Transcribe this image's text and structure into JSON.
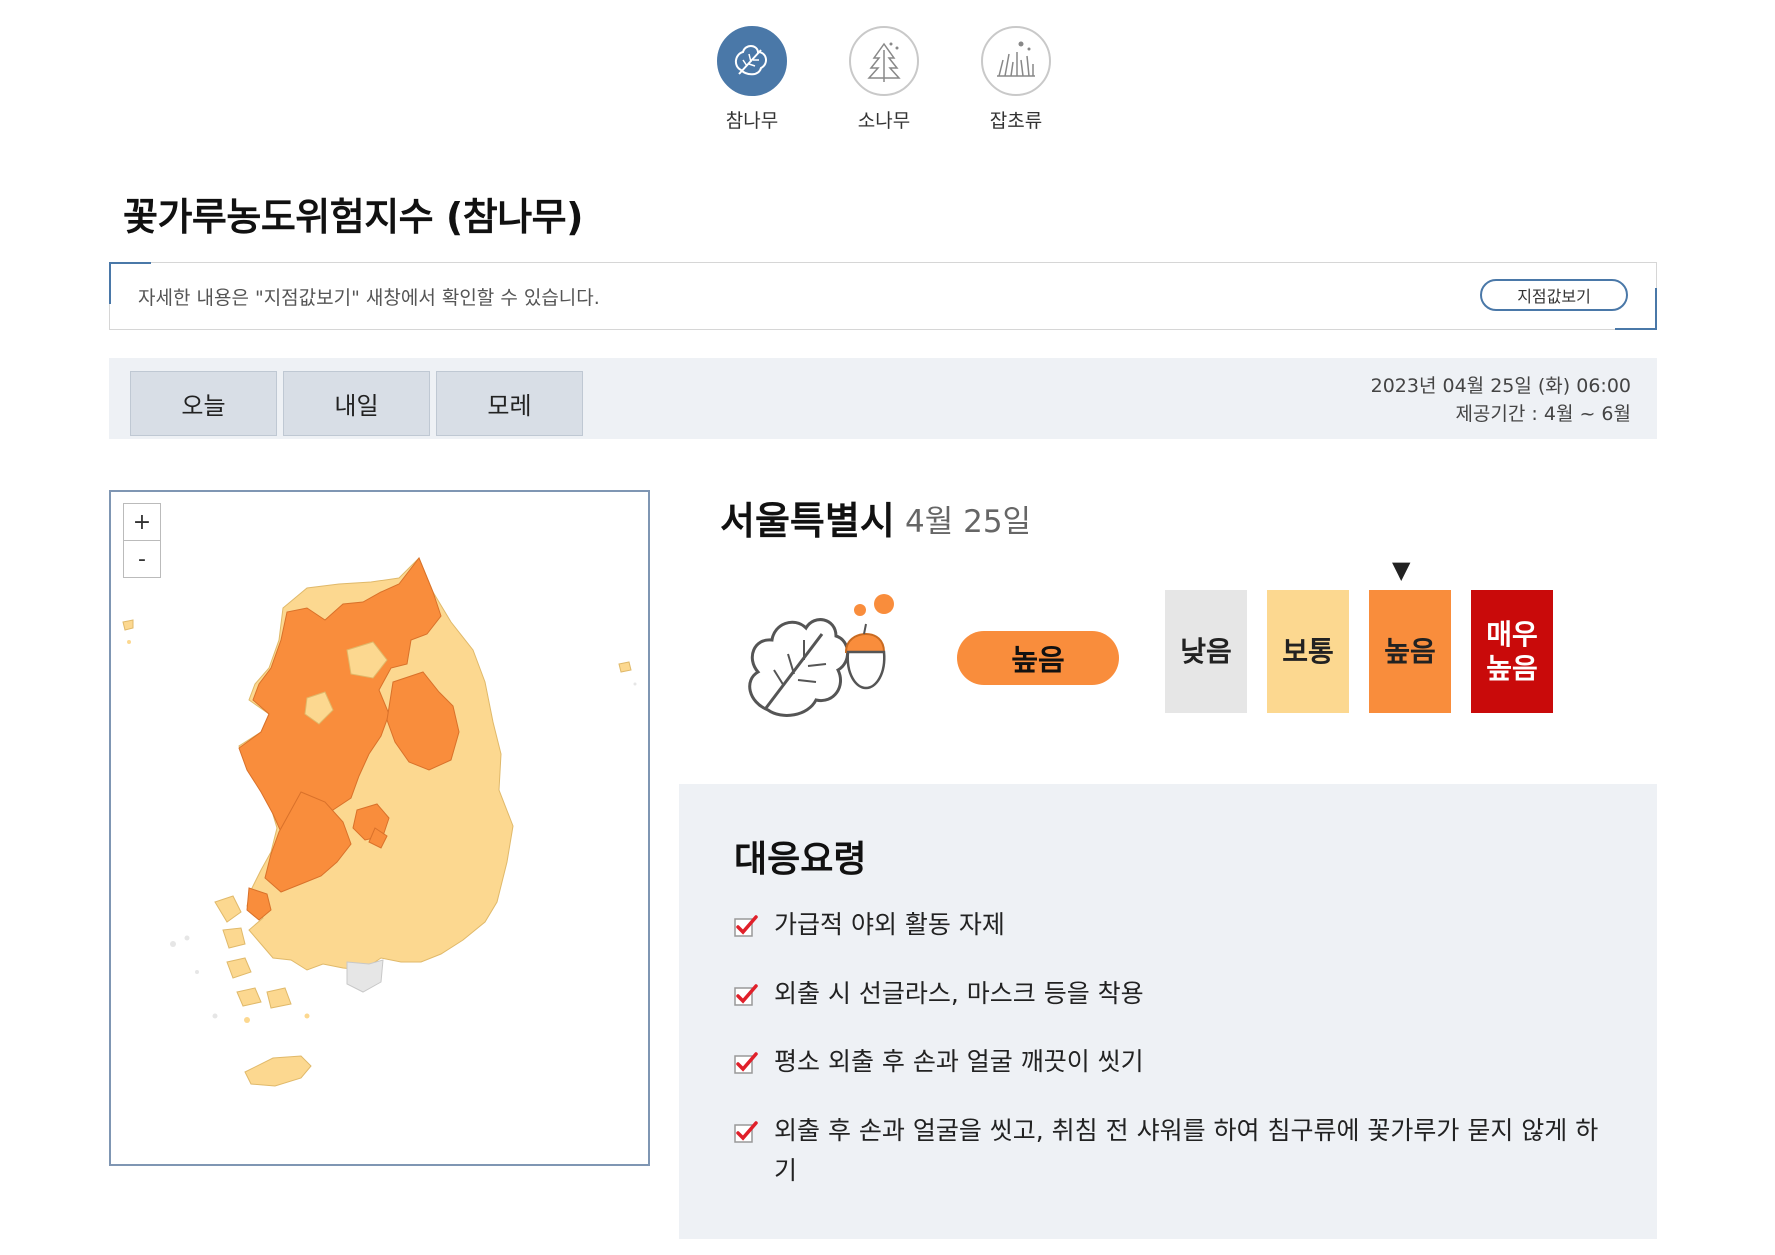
{
  "species_tabs": [
    {
      "label": "참나무",
      "icon": "oak-leaf-icon",
      "active": true
    },
    {
      "label": "소나무",
      "icon": "pine-tree-icon",
      "active": false
    },
    {
      "label": "잡초류",
      "icon": "weed-grass-icon",
      "active": false
    }
  ],
  "page_title": "꽃가루농도위험지수 (참나무)",
  "info": {
    "text": "자세한 내용은 \"지점값보기\" 새창에서 확인할 수 있습니다.",
    "button_label": "지점값보기"
  },
  "day_tabs": [
    "오늘",
    "내일",
    "모레"
  ],
  "date": {
    "datetime": "2023년 04월 25일 (화) 06:00",
    "period": "제공기간 : 4월 ~ 6월"
  },
  "map": {
    "zoom_in": "+",
    "zoom_out": "-"
  },
  "region": {
    "name": "서울특별시",
    "date": "4월 25일",
    "current_level": "높음"
  },
  "scale": [
    {
      "label": "낮음",
      "bg": "#e6e6e6",
      "fg": "#222222"
    },
    {
      "label": "보통",
      "bg": "#fcd890",
      "fg": "#222222"
    },
    {
      "label": "높음",
      "bg": "#f98d3c",
      "fg": "#222222"
    },
    {
      "label": "매우\n높음",
      "bg": "#c90a0a",
      "fg": "#ffffff"
    }
  ],
  "pointer": "▼",
  "colors": {
    "accent": "#4a78a8",
    "high": "#f98d3c",
    "normal": "#fcd890",
    "low": "#e6e6e6",
    "very_high": "#c90a0a",
    "check": "#e0202a"
  },
  "response": {
    "title": "대응요령",
    "items": [
      "가급적 야외 활동 자제",
      "외출 시 선글라스, 마스크 등을 착용",
      "평소 외출 후 손과 얼굴 깨끗이 씻기",
      "외출 후 손과 얼굴을 씻고, 취침 전 샤워를 하여 침구류에 꽃가루가 묻지 않게 하기"
    ]
  }
}
